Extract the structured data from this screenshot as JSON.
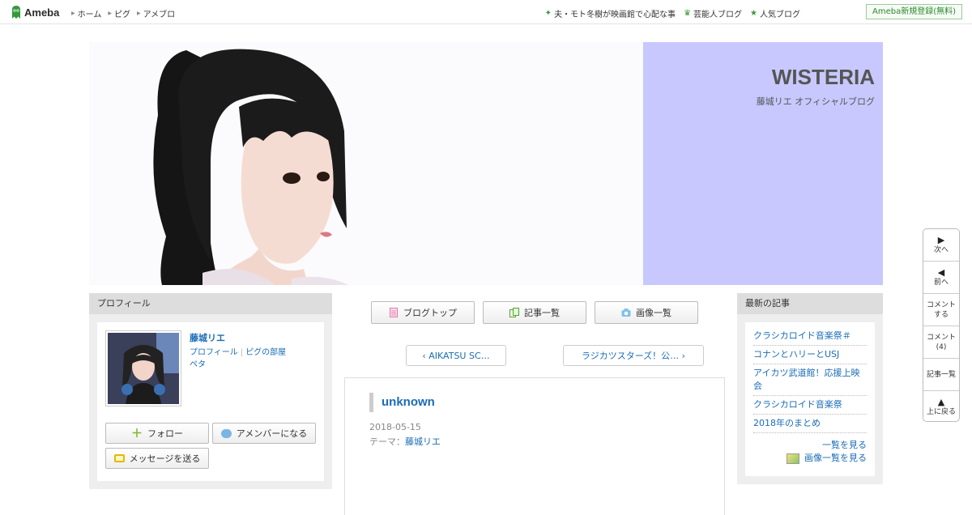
{
  "topbar": {
    "logo_text": "Ameba",
    "nav": [
      "ホーム",
      "ピグ",
      "アメブロ"
    ],
    "links": [
      {
        "label": "夫・モト冬樹が映画館で心配な事",
        "icon": "sparkle-icon"
      },
      {
        "label": "芸能人ブログ",
        "icon": "crown-icon"
      },
      {
        "label": "人気ブログ",
        "icon": "star-icon"
      }
    ],
    "register": "Ameba新規登録(無料)"
  },
  "header": {
    "title": "WISTERIA",
    "subtitle": "藤城リエ オフィシャルブログ",
    "banner_color": "#c8c8ff"
  },
  "profile": {
    "heading": "プロフィール",
    "name": "藤城リエ",
    "link_profile": "プロフィール",
    "link_room": "ピグの部屋",
    "link_peta": "ペタ",
    "follow": "フォロー",
    "member": "アメンバーになる",
    "message": "メッセージを送る"
  },
  "nav": {
    "blog_top": "ブログトップ",
    "article_list": "記事一覧",
    "image_list": "画像一覧"
  },
  "pager": {
    "prev": "AIKATSU SC…",
    "next": "ラジカツスターズ！公…"
  },
  "article": {
    "title": "unknown",
    "date": "2018-05-15",
    "theme_label": "テーマ：",
    "theme": "藤城リエ"
  },
  "recent": {
    "heading": "最新の記事",
    "items": [
      "クラシカロイド音楽祭＃",
      "コナンとハリーとUSJ",
      "アイカツ武道館！応援上映会",
      "クラシカロイド音楽祭",
      "2018年のまとめ"
    ],
    "more": "一覧を見る",
    "images": "画像一覧を見る"
  },
  "sidenav": {
    "next": "次へ",
    "prev": "前へ",
    "comment_1": "コメント",
    "comment_2": "する",
    "comments_1": "コメント",
    "comments_2": "(4)",
    "list": "記事一覧",
    "top": "上に戻る"
  }
}
